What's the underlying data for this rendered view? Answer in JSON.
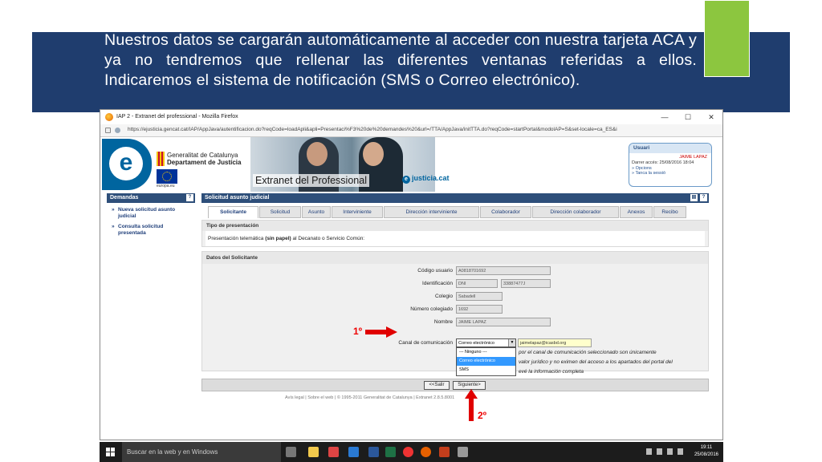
{
  "slide": {
    "text": "Nuestros datos se cargarán automáticamente al acceder con nuestra tarjeta ACA y ya no tendremos que rellenar las diferentes ventanas referidas a ellos. Indicaremos el sistema de notificación (SMS o Correo electrónico).",
    "colors": {
      "band": "#1f3d6e",
      "green": "#8cc63f"
    }
  },
  "browser": {
    "title": "IAP 2 - Extranet del professional - Mozilla Firefox",
    "url": "https://ejusticia.gencat.cat/IAP/AppJava/autentificacion.do?reqCode=loadApli&apli=Presentaci%F3%20de%20demandes%20&url=/TTA/AppJava/initTTA.do?reqCode=startPortal&modolAP=S&set-locale=ca_ES&i",
    "controls": {
      "minimize": "—",
      "maximize": "☐",
      "close": "✕"
    }
  },
  "header": {
    "gencat_line1": "Generalitat de Catalunya",
    "gencat_line2": "Departament de Justícia",
    "europa": "europa.eu",
    "extranet": "Extranet del Professional",
    "justicia": "justicia.cat",
    "user": {
      "heading": "Usuari",
      "name": "JAIME LAPAZ",
      "last_access": "Darrer accés: 25/08/2016 18:04",
      "options": "» Opcions",
      "close": "» Tanca la sessió"
    }
  },
  "left_panel": {
    "title": "Demandas",
    "help": "?",
    "items": [
      {
        "label": "Nueva solicitud asunto judicial"
      },
      {
        "label": "Consulta solicitud presentada"
      }
    ]
  },
  "main_panel": {
    "title": "Solicitud asunto judicial",
    "tabs": [
      {
        "label": "Solicitante"
      },
      {
        "label": "Solicitud"
      },
      {
        "label": "Asunto"
      },
      {
        "label": "Interviniente"
      },
      {
        "label": "Dirección interviniente"
      },
      {
        "label": "Colaborador"
      },
      {
        "label": "Dirección colaborador"
      },
      {
        "label": "Anexos"
      },
      {
        "label": "Recibo"
      }
    ],
    "presentation": {
      "heading": "Tipo de presentación",
      "text_pre": "Presentación telemática ",
      "text_bold": "(sin papel)",
      "text_post": " al Decanato o Servicio Común:"
    },
    "applicant": {
      "heading": "Datos del Solicitante",
      "fields": [
        {
          "label": "Código usuario",
          "value": "A0818701692"
        },
        {
          "label": "Identificación",
          "value": "DNI",
          "value2": "33887477J"
        },
        {
          "label": "Colegio",
          "value": "Sabadell"
        },
        {
          "label": "Número colegiado",
          "value": "1692"
        },
        {
          "label": "Nombre",
          "value": "JAIME LAPAZ"
        }
      ],
      "channel_label": "Canal de comunicación",
      "channel_selected": "Correo electrónico",
      "channel_options": [
        "--- Ninguno ---",
        "Correo electrónico",
        "SMS"
      ],
      "email": "jaimelapaz@icasbd.org",
      "note_line1": "por el canal de comunicación seleccionado son únicamente",
      "note_line2": "valor jurídico y no eximen del acceso a los apartados del portal del",
      "note_line3": "evé la información completa"
    },
    "buttons": {
      "back": "<<Salir",
      "next": "Siguiente>"
    }
  },
  "footer": "Avís legal  |  Sobre el web  |  © 1995-2011 Generalitat de Catalunya  |  Extranet 2.8.5.8001",
  "annotations": {
    "step1": "1º",
    "step2": "2º",
    "color": "#e00000"
  },
  "taskbar": {
    "search": "Buscar en la web y en Windows",
    "time": "19:11",
    "date": "25/08/2016"
  }
}
